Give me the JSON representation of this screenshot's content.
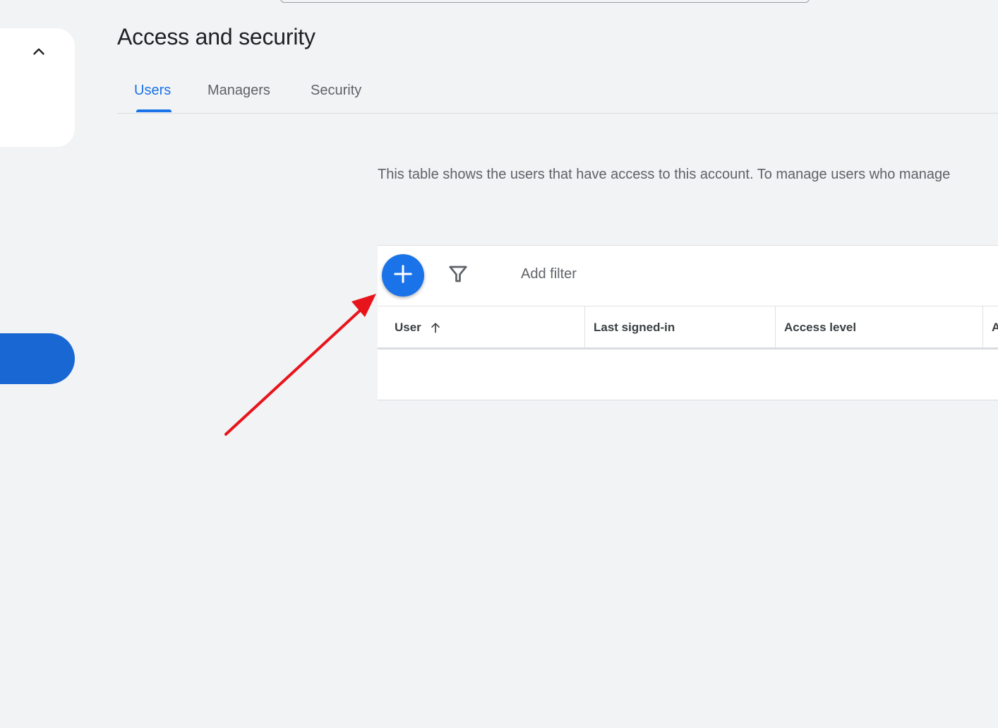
{
  "page": {
    "title": "Access and security"
  },
  "tabs": [
    {
      "label": "Users",
      "active": true
    },
    {
      "label": "Managers",
      "active": false
    },
    {
      "label": "Security",
      "active": false
    }
  ],
  "description": "This table shows the users that have access to this account. To manage users who manage",
  "toolbar": {
    "add_icon": "plus-icon",
    "filter_icon": "filter-icon",
    "add_filter_label": "Add filter"
  },
  "table": {
    "columns": [
      {
        "label": "User",
        "sort": "ascending"
      },
      {
        "label": "Last signed-in"
      },
      {
        "label": "Access level"
      },
      {
        "label": "A"
      }
    ]
  },
  "colors": {
    "accent": "#1a73e8",
    "sidebar_pill": "#1967d2",
    "background": "#f1f3f4",
    "annotation_arrow": "#e8141c"
  }
}
